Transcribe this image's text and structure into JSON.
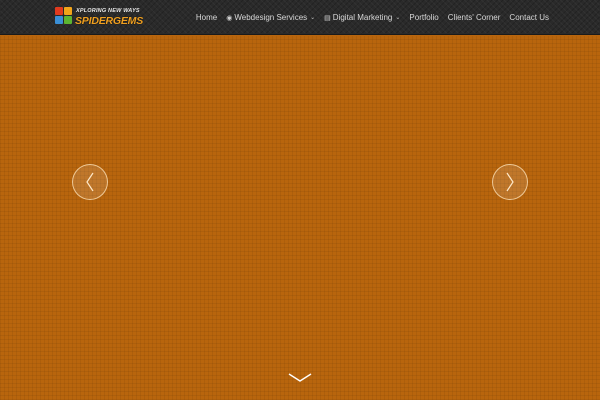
{
  "logo": {
    "tagline": "XPLORING NEW WAYS",
    "name": "SPIDERGEMS",
    "colors": [
      "#e03a1e",
      "#f2a51a",
      "#3a8fd6",
      "#5cb531"
    ]
  },
  "nav": {
    "items": [
      {
        "label": "Home",
        "icon": "",
        "has_dropdown": false
      },
      {
        "label": "Webdesign Services",
        "icon": "globe-icon",
        "has_dropdown": true
      },
      {
        "label": "Digital Marketing",
        "icon": "briefcase-icon",
        "has_dropdown": true
      },
      {
        "label": "Portfolio",
        "icon": "",
        "has_dropdown": false
      },
      {
        "label": "Clients' Corner",
        "icon": "",
        "has_dropdown": false
      },
      {
        "label": "Contact Us",
        "icon": "",
        "has_dropdown": false
      }
    ]
  },
  "hero": {
    "background_color": "#b8650d",
    "prev_icon": "chevron-left-icon",
    "next_icon": "chevron-right-icon",
    "scroll_icon": "chevron-down-icon"
  }
}
